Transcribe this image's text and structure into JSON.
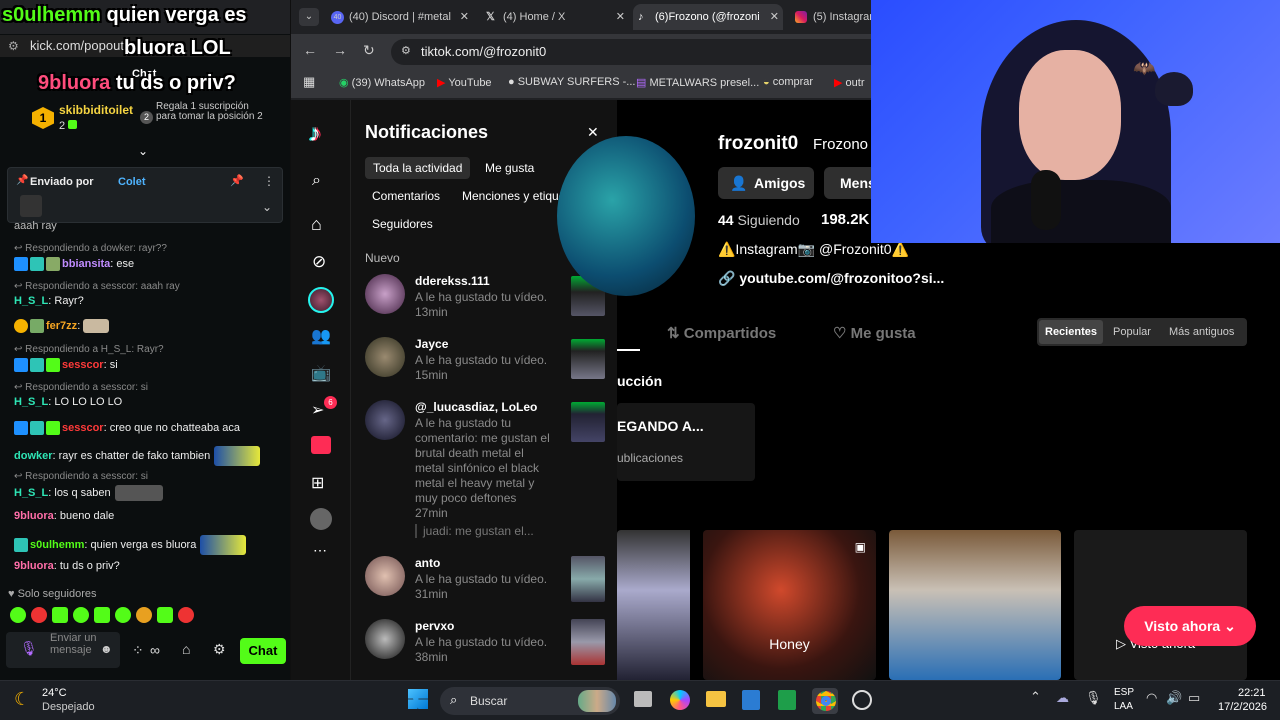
{
  "kick": {
    "url": "kick.com/popout/",
    "overlay_line1_name": "s0ulhemm",
    "overlay_line1_text": "quien verga es",
    "overlay_line2": "bluora LOL",
    "overlay_chat_label": "Chat",
    "overlay_line3_name": "9bluora",
    "overlay_line3_text": "tu ds o priv?",
    "leaderboard_rank": "1",
    "leaderboard_user": "skibbiditoilet",
    "leaderboard_count": "2",
    "gift_rank": "2",
    "gift_text": "Regala 1 suscripción para tomar la posición 2",
    "pinned_label": "Enviado por",
    "pinned_user": "Colet",
    "partial_line": "aaah ray",
    "messages": [
      {
        "reply": "Respondiendo a dowker: rayr??"
      },
      {
        "user": "bbiansita",
        "text": "ese"
      },
      {
        "reply": "Respondiendo a sesscor: aaah ray"
      },
      {
        "user": "H_S_L",
        "text": "Rayr?"
      },
      {
        "user": "fer7zz",
        "text": ""
      },
      {
        "reply": "Respondiendo a H_S_L: Rayr?"
      },
      {
        "user": "sesscor",
        "text": "si"
      },
      {
        "reply": "Respondiendo a sesscor: si"
      },
      {
        "user": "H_S_L",
        "text": "LO LO LO LO"
      },
      {
        "user": "sesscor",
        "text": "creo que no chatteaba aca"
      },
      {
        "user": "dowker",
        "text": "rayr es chatter de fako tambien"
      },
      {
        "reply": "Respondiendo a sesscor: si"
      },
      {
        "user": "H_S_L",
        "text": "los q saben"
      },
      {
        "user": "9bluora",
        "text": "bueno dale"
      },
      {
        "user": "s0ulhemm",
        "text": "quien verga es bluora"
      },
      {
        "user": "9bluora",
        "text": "tu ds o priv?"
      }
    ],
    "followers_only": "Solo seguidores",
    "input_placeholder": "Enviar un mensaje",
    "chat_button": "Chat"
  },
  "browser": {
    "tabs": [
      {
        "label": "(40) Discord | #metal"
      },
      {
        "label": "(4) Home / X"
      },
      {
        "label": "(6)Frozono (@frozoni"
      },
      {
        "label": "(5) Instagram"
      }
    ],
    "discord_badge": "40",
    "url": "tiktok.com/@frozonit0",
    "bookmarks": [
      "(39) WhatsApp",
      "YouTube",
      "SUBWAY SURFERS -...",
      "METALWARS presel...",
      "comprar",
      "outr"
    ]
  },
  "tiktok": {
    "inbox_badge": "6",
    "notif_title": "Notificaciones",
    "filters": [
      "Toda la actividad",
      "Me gusta",
      "Comentarios",
      "Menciones y etiquetas",
      "Seguidores"
    ],
    "section_new": "Nuevo",
    "notifications": [
      {
        "user": "dderekss.111",
        "text": "A le ha gustado tu vídeo.",
        "time": "13min"
      },
      {
        "user": "Jayce",
        "text": "A le ha gustado tu vídeo.",
        "time": "15min"
      },
      {
        "user": "@_luucasdiaz, LoLeo",
        "text": "A le ha gustado tu comentario: me gustan el brutal death metal el metal sinfónico el black metal el heavy metal y muy poco deftones",
        "time": "27min",
        "quote": "juadi: me gustan el..."
      },
      {
        "user": "anto",
        "text": "A le ha gustado tu vídeo.",
        "time": "31min"
      },
      {
        "user": "pervxo",
        "text": "A le ha gustado tu vídeo.",
        "time": "38min"
      }
    ],
    "profile": {
      "username": "frozonit0",
      "display": "Frozono",
      "friends_button": "Amigos",
      "message_button": "Mens",
      "following_count": "44",
      "following_label": "Siguiendo",
      "followers_count": "198.2K",
      "bio": "⚠️Instagram📷 @Frozonit0⚠️",
      "link": "youtube.com/@frozonitoo?si...",
      "tab_shared": "Compartidos",
      "tab_likes": "Me gusta",
      "sort": [
        "Recientes",
        "Popular",
        "Más antiguos"
      ],
      "section": "ucción",
      "playlist_title": "EGANDO A...",
      "playlist_sub": "ublicaciones",
      "video_caption": "Honey",
      "watch_now": "Visto ahora",
      "watch_button": "Visto ahora"
    }
  },
  "taskbar": {
    "temp": "24°C",
    "weather": "Despejado",
    "search": "Buscar",
    "lang1": "ESP",
    "lang2": "LAA",
    "time": "22:21",
    "date": "17/2/2026"
  }
}
